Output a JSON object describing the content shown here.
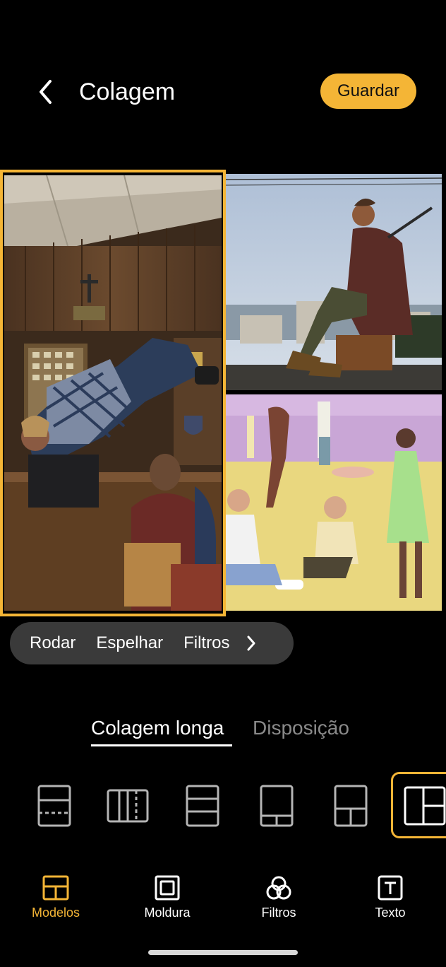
{
  "header": {
    "title": "Colagem",
    "save_label": "Guardar"
  },
  "photo_actions": {
    "rotate": "Rodar",
    "mirror": "Espelhar",
    "filters": "Filtros"
  },
  "tabs": {
    "long_collage": "Colagem longa",
    "layout": "Disposição"
  },
  "bottom_nav": {
    "templates": "Modelos",
    "frame": "Moldura",
    "filters": "Filtros",
    "text": "Texto"
  },
  "colors": {
    "accent": "#f4b536",
    "background": "#000000",
    "pill": "#3a3a3a",
    "inactive_tab": "#8a8a8a"
  },
  "icons": [
    "back-chevron-icon",
    "chevron-right-icon",
    "templates-icon",
    "frame-icon",
    "filters-icon",
    "text-icon"
  ]
}
